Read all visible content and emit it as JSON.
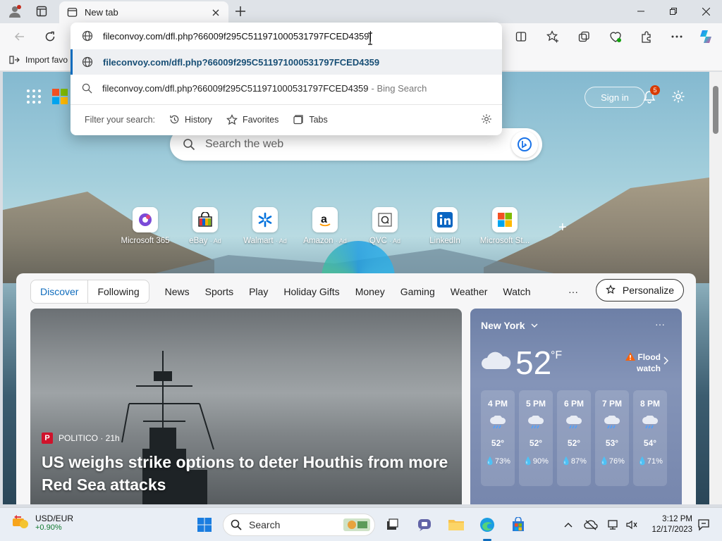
{
  "browser": {
    "tab_title": "New tab",
    "favorites_bar_item": "Import favo",
    "address_text": "fileconvoy.com/dfl.php?66009f295C511971000531797FCED4359"
  },
  "omnibox": {
    "suggestions": [
      {
        "text": "fileconvoy.com/dfl.php?66009f295C511971000531797FCED4359",
        "suffix": "",
        "icon": "globe-icon"
      },
      {
        "text": "fileconvoy.com/dfl.php?66009f295C511971000531797FCED4359",
        "suffix": "- Bing Search",
        "icon": "search-icon"
      }
    ],
    "filter_label": "Filter your search:",
    "filters": [
      "History",
      "Favorites",
      "Tabs"
    ]
  },
  "newtab": {
    "sign_in": "Sign in",
    "notification_count": "5",
    "search_placeholder": "Search the web",
    "quick_links": [
      {
        "label": "Microsoft 365",
        "ad": ""
      },
      {
        "label": "eBay",
        "ad": "· Ad"
      },
      {
        "label": "Walmart",
        "ad": "· Ad"
      },
      {
        "label": "Amazon",
        "ad": "· Ad"
      },
      {
        "label": "QVC",
        "ad": "· Ad"
      },
      {
        "label": "LinkedIn",
        "ad": ""
      },
      {
        "label": "Microsoft St...",
        "ad": ""
      }
    ],
    "feed_tabs": {
      "discover": "Discover",
      "following": "Following"
    },
    "nav": [
      "News",
      "Sports",
      "Play",
      "Holiday Gifts",
      "Money",
      "Gaming",
      "Weather",
      "Watch"
    ],
    "more": "···",
    "personalize": "Personalize",
    "hero": {
      "source": "POLITICO · 21h",
      "title": "US weighs strike options to deter Houthis from more Red Sea attacks"
    },
    "weather": {
      "city": "New York",
      "temp": "52",
      "unit": "°F",
      "alert_line1": "Flood",
      "alert_line2": "watch",
      "hours": [
        {
          "time": "4 PM",
          "temp": "52°",
          "rain": "73%"
        },
        {
          "time": "5 PM",
          "temp": "52°",
          "rain": "90%"
        },
        {
          "time": "6 PM",
          "temp": "52°",
          "rain": "87%"
        },
        {
          "time": "7 PM",
          "temp": "53°",
          "rain": "76%"
        },
        {
          "time": "8 PM",
          "temp": "54°",
          "rain": "71%"
        }
      ]
    }
  },
  "taskbar": {
    "widget_name": "USD/EUR",
    "widget_value": "+0.90%",
    "search_label": "Search",
    "time": "3:12 PM",
    "date": "12/17/2023"
  },
  "colors": {
    "accent": "#0f6cbd",
    "alert": "#d83b01",
    "gain": "#127b31"
  }
}
